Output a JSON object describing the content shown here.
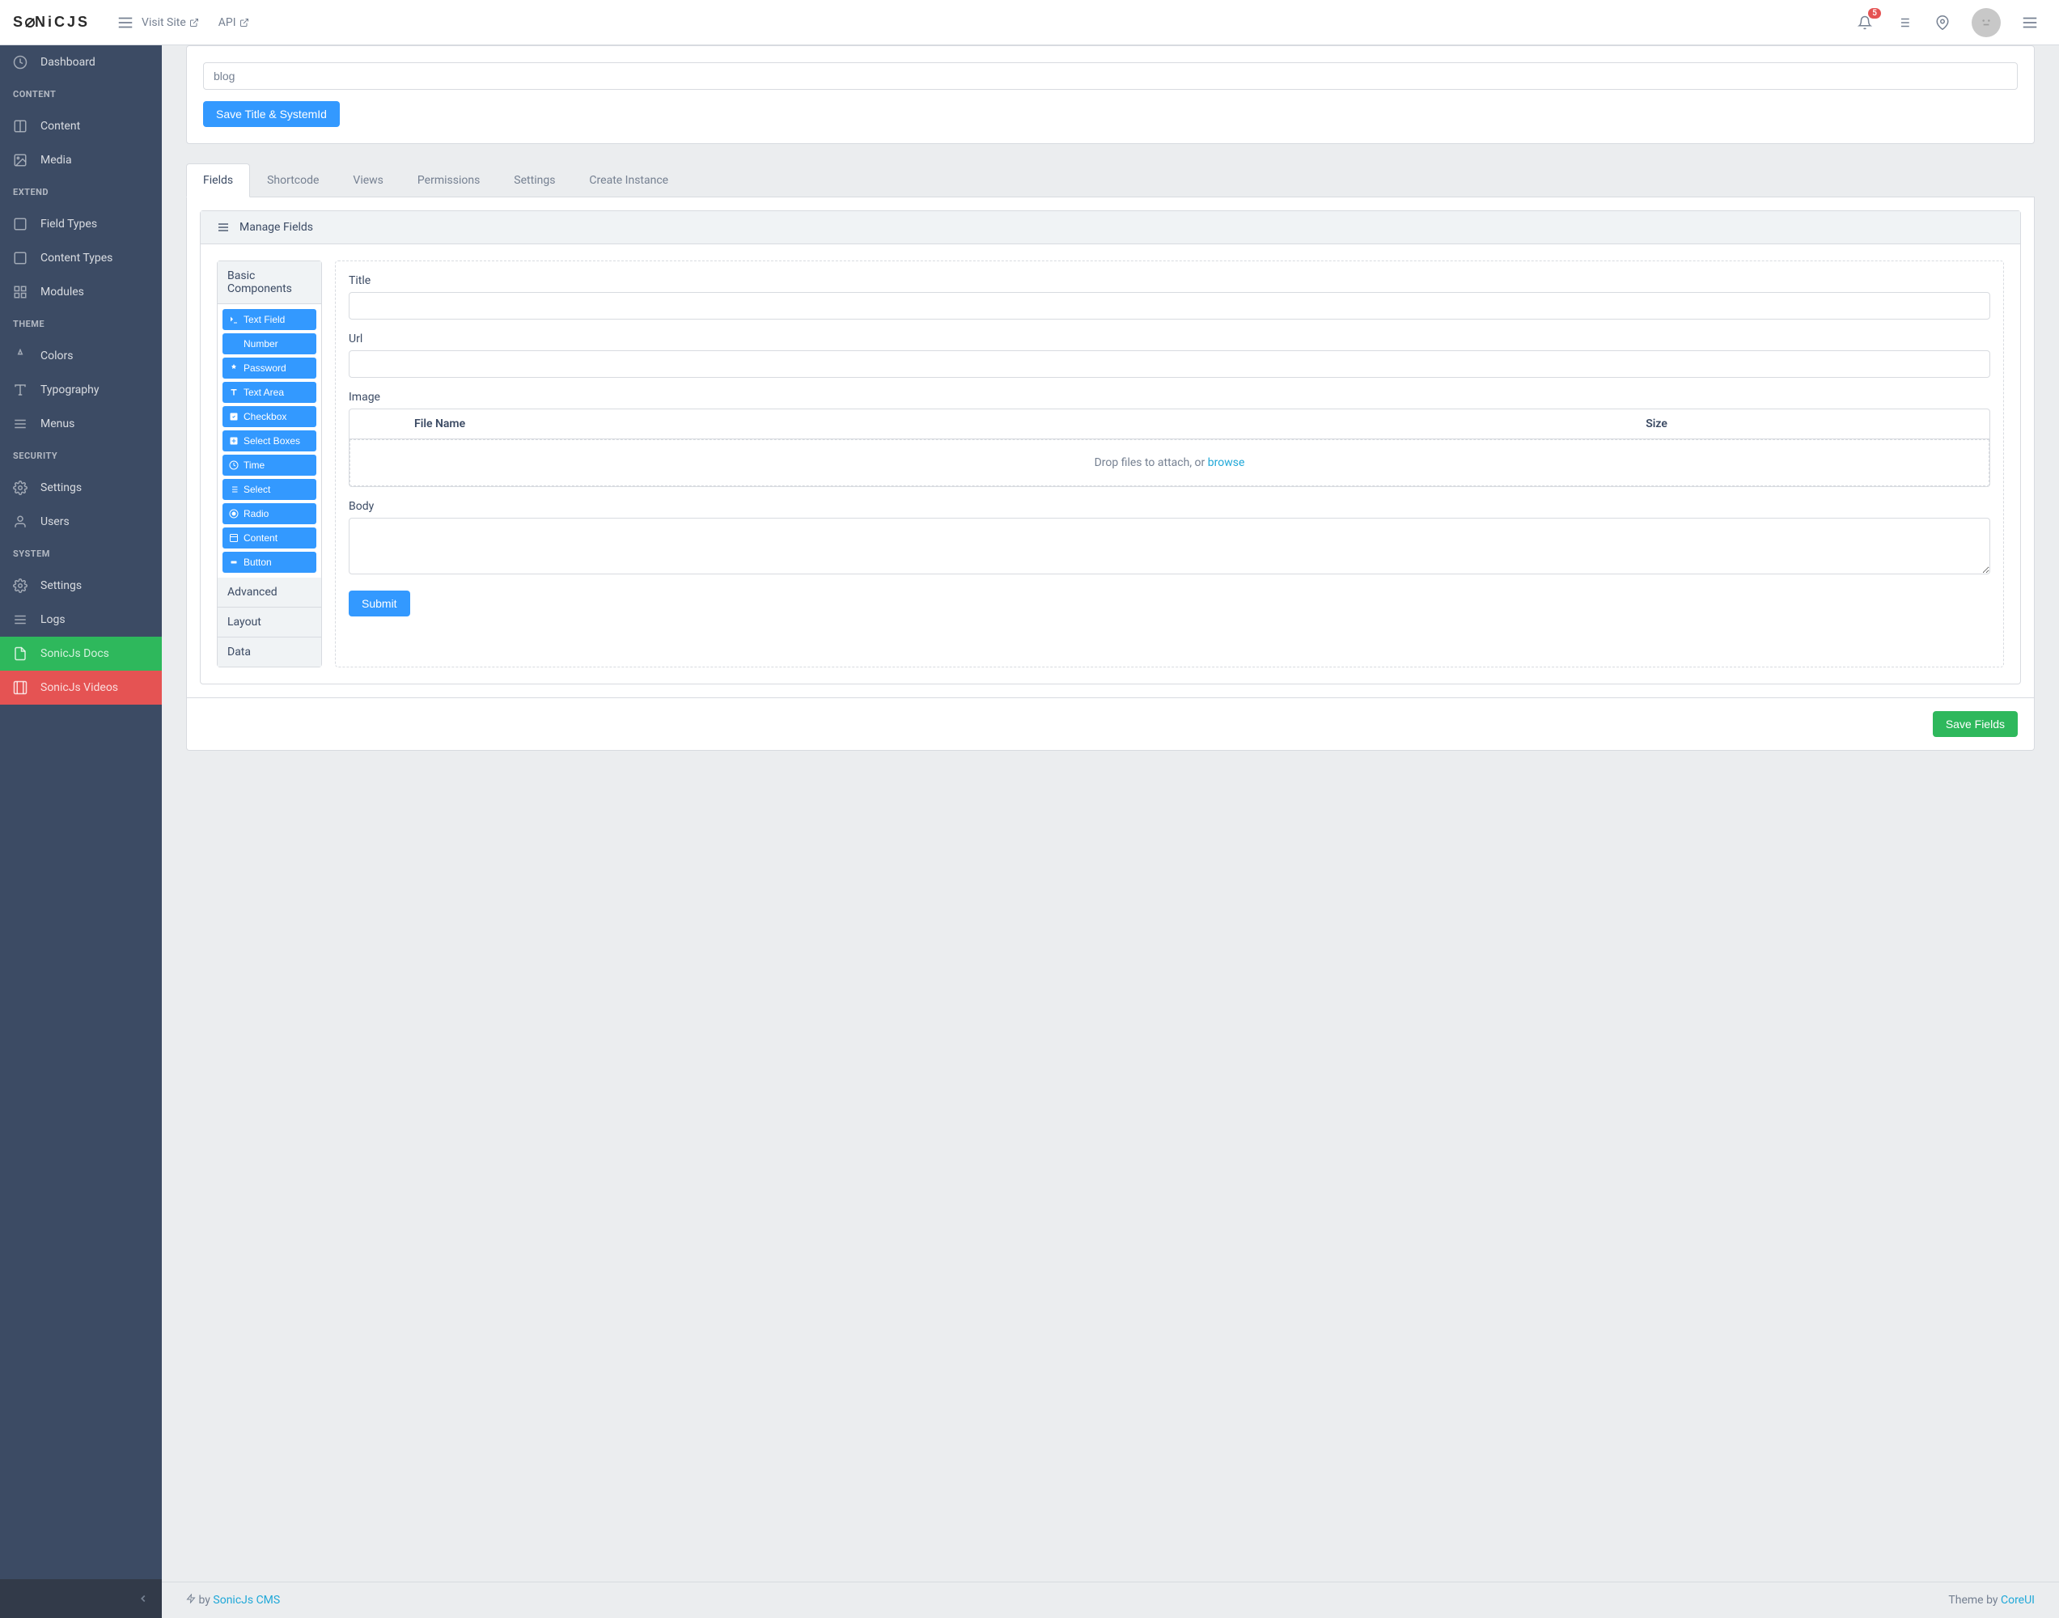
{
  "header": {
    "visit_site": "Visit Site",
    "api": "API",
    "notification_count": "5"
  },
  "sidebar": {
    "dashboard": "Dashboard",
    "section_content": "CONTENT",
    "content": "Content",
    "media": "Media",
    "section_extend": "EXTEND",
    "field_types": "Field Types",
    "content_types": "Content Types",
    "modules": "Modules",
    "section_theme": "THEME",
    "colors": "Colors",
    "typography": "Typography",
    "menus": "Menus",
    "section_security": "SECURITY",
    "settings": "Settings",
    "users": "Users",
    "section_system": "SYSTEM",
    "system_settings": "Settings",
    "logs": "Logs",
    "docs": "SonicJs Docs",
    "videos": "SonicJs Videos"
  },
  "top_card": {
    "title_value": "blog",
    "save_btn": "Save Title & SystemId"
  },
  "tabs": {
    "fields": "Fields",
    "shortcode": "Shortcode",
    "views": "Views",
    "permissions": "Permissions",
    "settings": "Settings",
    "create_instance": "Create Instance"
  },
  "panel": {
    "header": "Manage Fields",
    "groups": {
      "basic": "Basic Components",
      "advanced": "Advanced",
      "layout": "Layout",
      "data": "Data"
    },
    "components": {
      "text_field": "Text Field",
      "number": "Number",
      "password": "Password",
      "text_area": "Text Area",
      "checkbox": "Checkbox",
      "select_boxes": "Select Boxes",
      "time": "Time",
      "select": "Select",
      "radio": "Radio",
      "content": "Content",
      "button": "Button"
    }
  },
  "form": {
    "title_label": "Title",
    "url_label": "Url",
    "image_label": "Image",
    "file_name_col": "File Name",
    "size_col": "Size",
    "drop_text": "Drop files to attach, or ",
    "browse": "browse",
    "body_label": "Body",
    "submit": "Submit",
    "save_fields": "Save Fields"
  },
  "footer": {
    "by": "by",
    "cms": "SonicJs CMS",
    "theme_by": "Theme by",
    "coreui": "CoreUI"
  }
}
